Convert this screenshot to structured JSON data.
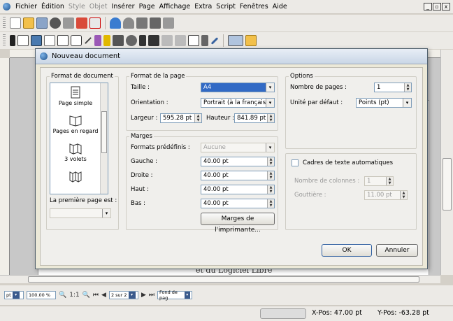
{
  "menu": [
    "Fichier",
    "Édition",
    "Style",
    "Objet",
    "Insérer",
    "Page",
    "Affichage",
    "Extra",
    "Script",
    "Fenêtres",
    "Aide"
  ],
  "menu_disabled": [
    2,
    3
  ],
  "window_controls": [
    "_",
    "▫",
    "x"
  ],
  "workspace": {
    "page_text": "et du Logiciel Libre"
  },
  "status": {
    "unit": "pt",
    "zoom": "100.00 %",
    "zoom_ratio": "1:1",
    "page": "2 sur 2",
    "layer": "Fond de pag",
    "xpos_label": "X-Pos:",
    "xpos": "47.00 pt",
    "ypos_label": "Y-Pos:",
    "ypos": "-63.28 pt"
  },
  "dialog": {
    "title": "Nouveau document",
    "doc_format": {
      "title": "Format de document",
      "items": [
        "Page simple",
        "Pages en regard",
        "3 volets",
        ""
      ],
      "first_page_label": "La première page est :",
      "first_page_value": ""
    },
    "page_format": {
      "title": "Format de la page",
      "size_label": "Taille :",
      "size_value": "A4",
      "orientation_label": "Orientation :",
      "orientation_value": "Portrait (à la française)",
      "width_label": "Largeur :",
      "width_value": "595.28 pt",
      "height_label": "Hauteur :",
      "height_value": "841.89 pt"
    },
    "margins": {
      "title": "Marges",
      "preset_label": "Formats prédéfinis :",
      "preset_value": "Aucune",
      "left_label": "Gauche :",
      "left_value": "40.00 pt",
      "right_label": "Droite :",
      "right_value": "40.00 pt",
      "top_label": "Haut :",
      "top_value": "40.00 pt",
      "bottom_label": "Bas :",
      "bottom_value": "40.00 pt",
      "printer_button": "Marges de l'imprimante..."
    },
    "options": {
      "title": "Options",
      "pages_label": "Nombre de pages :",
      "pages_value": "1",
      "unit_label": "Unité par défaut :",
      "unit_value": "Points (pt)"
    },
    "auto_frames": {
      "title": "Cadres de texte automatiques",
      "columns_label": "Nombre de colonnes :",
      "columns_value": "1",
      "gutter_label": "Gouttière :",
      "gutter_value": "11.00 pt"
    },
    "ok_label": "OK",
    "cancel_label": "Annuler"
  }
}
